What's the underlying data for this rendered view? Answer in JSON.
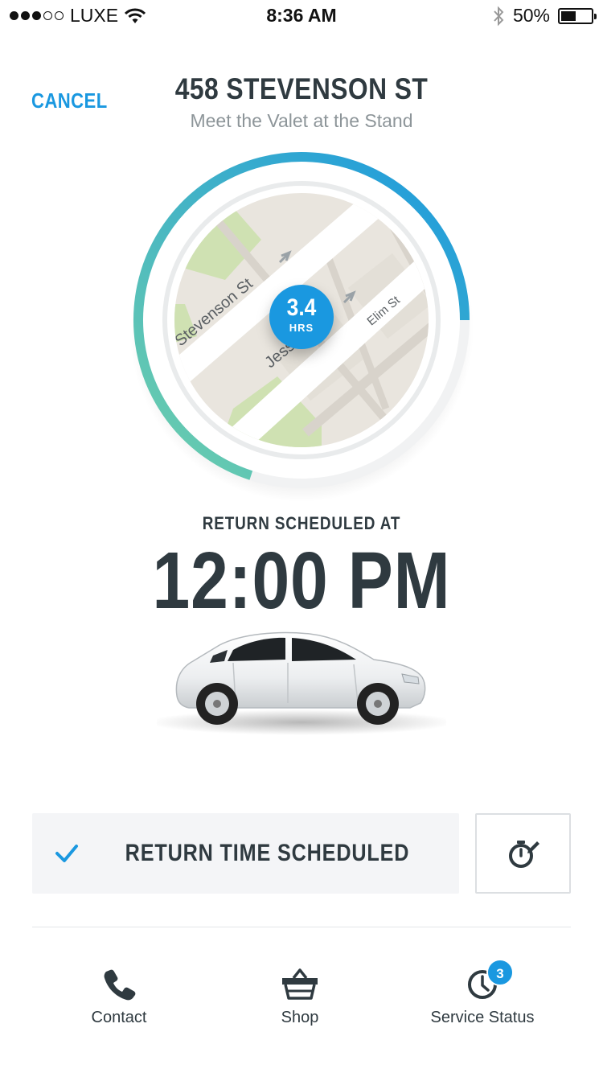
{
  "status_bar": {
    "carrier": "LUXE",
    "time": "8:36 AM",
    "battery": "50%",
    "battery_level": 0.5,
    "signal_bars": 3,
    "signal_total": 5
  },
  "header": {
    "cancel_label": "CANCEL",
    "title": "458 STEVENSON ST",
    "subtitle": "Meet the Valet at the Stand"
  },
  "map": {
    "streets": [
      "Stevenson St",
      "Jessie",
      "Elim St"
    ],
    "duration_value": "3.4",
    "duration_unit": "HRS",
    "progress_fraction": 0.7
  },
  "return": {
    "label": "RETURN SCHEDULED AT",
    "time": "12:00 PM"
  },
  "actions": {
    "scheduled_label": "RETURN TIME SCHEDULED",
    "edit_icon": "stopwatch-edit-icon"
  },
  "nav": {
    "items": [
      {
        "label": "Contact",
        "icon": "phone-icon"
      },
      {
        "label": "Shop",
        "icon": "basket-icon"
      },
      {
        "label": "Service Status",
        "icon": "clock-icon",
        "badge": "3"
      }
    ]
  },
  "colors": {
    "accent": "#1a98e0",
    "ring_start": "#6fd0aa",
    "ring_end": "#1a98e0",
    "text_dark": "#2f3a40",
    "text_muted": "#8d9599",
    "button_bg": "#f4f5f7"
  }
}
